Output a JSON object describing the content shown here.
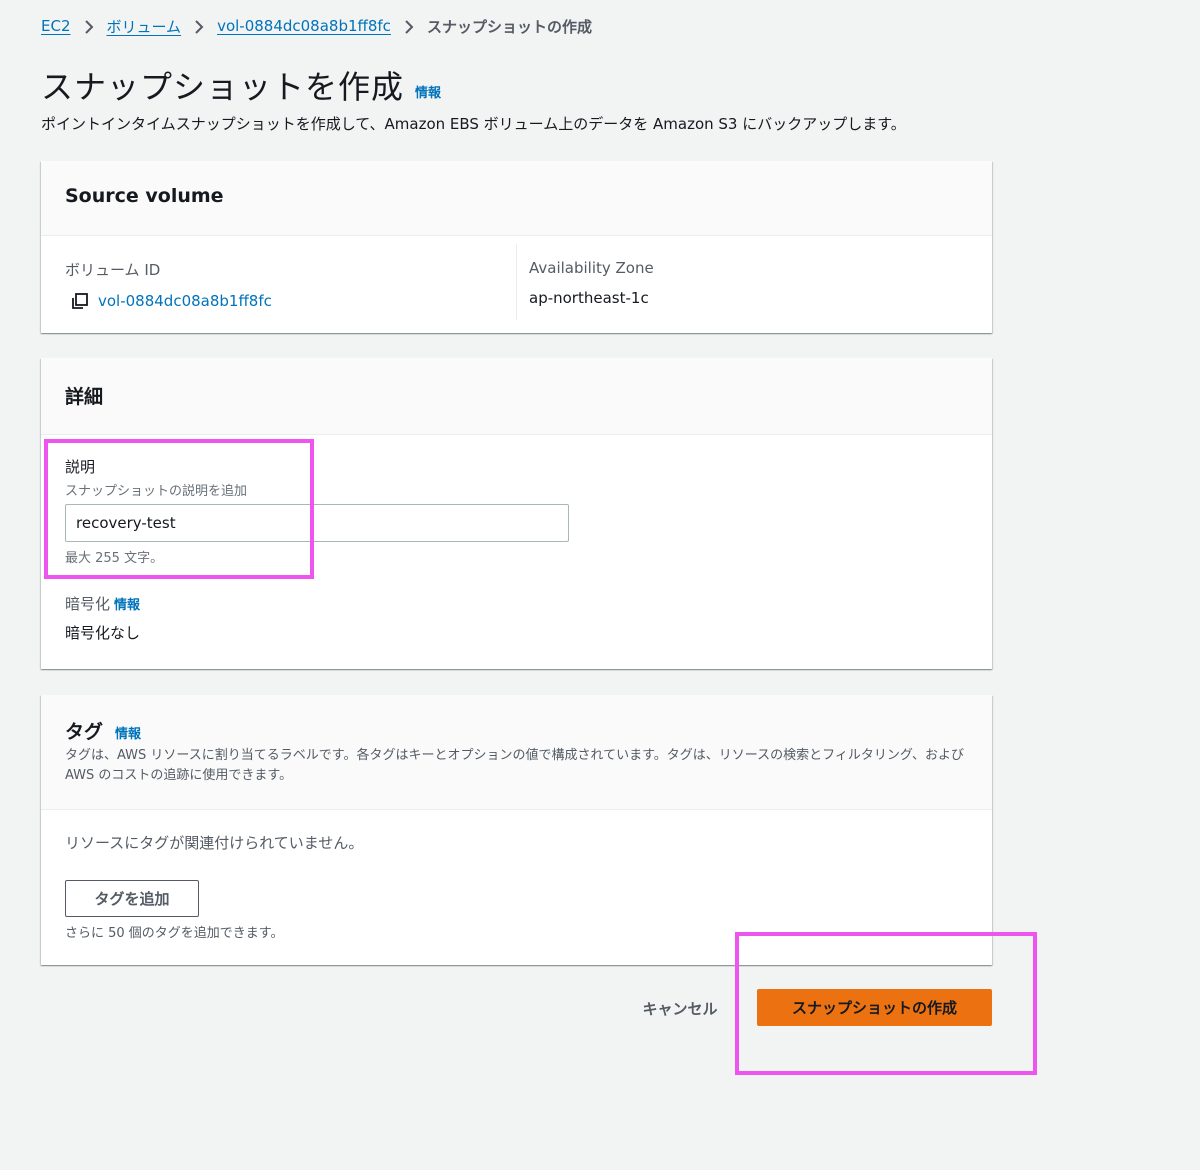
{
  "breadcrumb": {
    "items": [
      "EC2",
      "ボリューム",
      "vol-0884dc08a8b1ff8fc"
    ],
    "current": "スナップショットの作成"
  },
  "header": {
    "title": "スナップショットを作成",
    "info_link": "情報",
    "description": "ポイントインタイムスナップショットを作成して、Amazon EBS ボリューム上のデータを Amazon S3 にバックアップします。"
  },
  "source_volume": {
    "title": "Source volume",
    "volume_id_label": "ボリューム ID",
    "volume_id_value": "vol-0884dc08a8b1ff8fc",
    "az_label": "Availability Zone",
    "az_value": "ap-northeast-1c"
  },
  "details": {
    "title": "詳細",
    "description_label": "説明",
    "description_hint": "スナップショットの説明を追加",
    "description_value": "recovery-test",
    "description_constraint": "最大 255 文字。",
    "encryption_label": "暗号化",
    "encryption_info": "情報",
    "encryption_value": "暗号化なし"
  },
  "tags": {
    "title": "タグ",
    "info_link": "情報",
    "description": "タグは、AWS リソースに割り当てるラベルです。各タグはキーとオプションの値で構成されています。タグは、リソースの検索とフィルタリング、および AWS のコストの追跡に使用できます。",
    "no_tags": "リソースにタグが関連付けられていません。",
    "add_tag_button": "タグを追加",
    "tag_limit": "さらに 50 個のタグを追加できます。"
  },
  "footer": {
    "cancel_button": "キャンセル",
    "create_button": "スナップショットの作成"
  },
  "colors": {
    "link": "#0073bb",
    "primary_button": "#ec7211",
    "highlight": "#ee55ee",
    "background": "#f2f3f3"
  },
  "icons": {
    "breadcrumb_separator": "chevron-right-icon",
    "copy": "copy-icon"
  }
}
